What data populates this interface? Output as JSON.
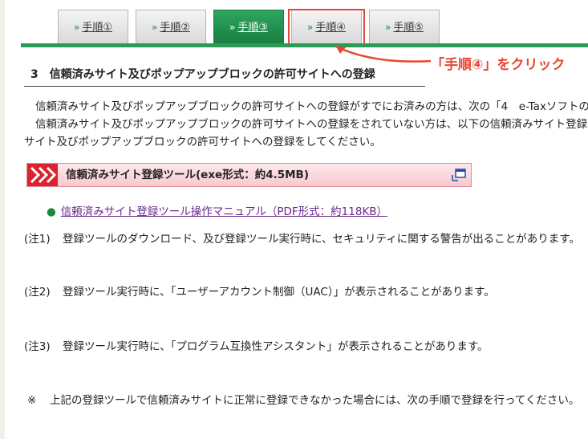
{
  "tabs": [
    {
      "label": "手順①"
    },
    {
      "label": "手順②"
    },
    {
      "label": "手順③"
    },
    {
      "label": "手順④"
    },
    {
      "label": "手順⑤"
    }
  ],
  "tab_chevron": "»",
  "active_tab": "手順③",
  "highlighted_tab": "手順④",
  "callout": "「手順④」をクリック",
  "section": {
    "heading": "3　信頼済みサイト及びポップアップブロックの許可サイトへの登録"
  },
  "body": {
    "line1": "信頼済みサイト及びポップアップブロックの許可サイトへの登録がすでにお済みの方は、次の「4　e-Taxソフトの",
    "line2": "信頼済みサイト及びポップアップブロックの許可サイトへの登録をされていない方は、以下の信頼済みサイト登録",
    "line3": "サイト及びポップアップブロックの許可サイトへの登録をしてください。"
  },
  "tool": {
    "label": "信頼済みサイト登録ツール(exe形式：約4.5MB)"
  },
  "manual": {
    "link": "信頼済みサイト登録ツール操作マニュアル（PDF形式：約118KB）"
  },
  "notes": [
    {
      "tag": "(注1)",
      "text": "登録ツールのダウンロード、及び登録ツール実行時に、セキュリティに関する警告が出ることがあります。"
    },
    {
      "tag": "(注2)",
      "text": "登録ツール実行時に、「ユーザーアカウント制御（UAC）」が表示されることがあります。"
    },
    {
      "tag": "(注3)",
      "text": "登録ツール実行時に、「プログラム互換性アシスタント」が表示されることがあります。"
    },
    {
      "tag": "※",
      "text": "上記の登録ツールで信頼済みサイトに正常に登録できなかった場合には、次の手順で登録を行ってください。"
    }
  ],
  "colors": {
    "tab_active": "#1a7f42",
    "highlight": "#e0463a",
    "callout": "#e8472f",
    "tool_banner": "#f8c9cf",
    "link": "#6a2a8a"
  }
}
